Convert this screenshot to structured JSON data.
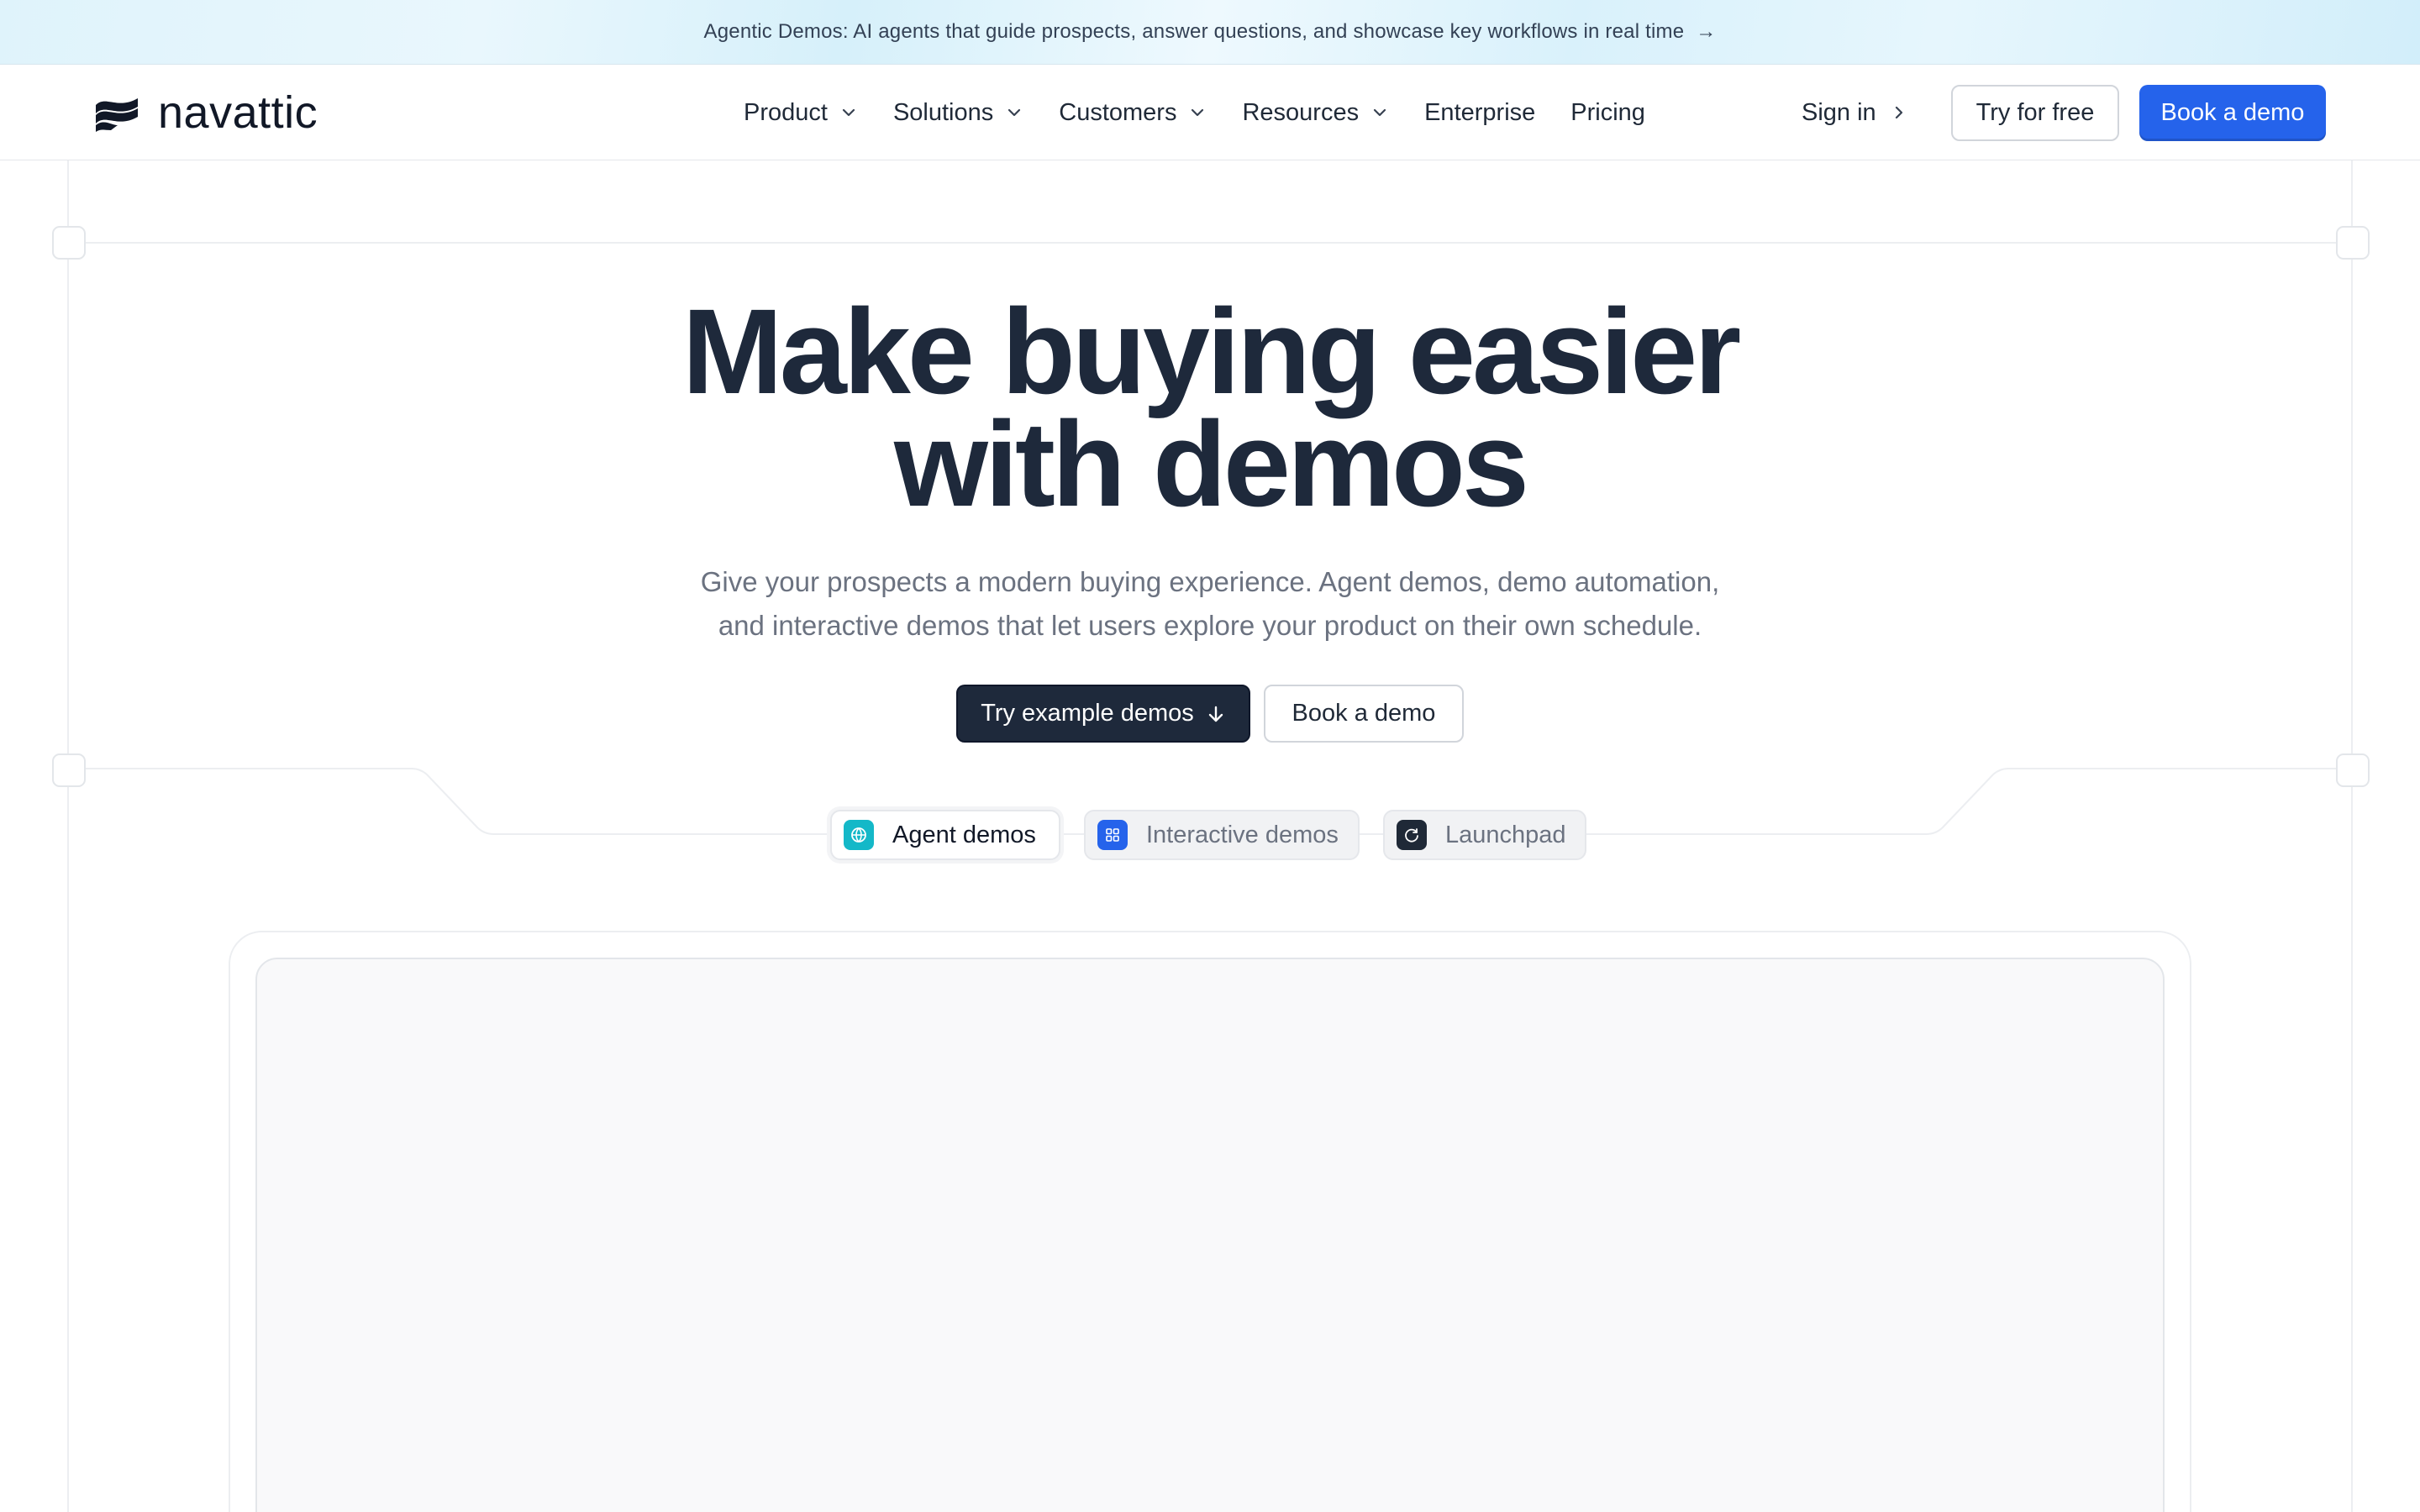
{
  "announcement": {
    "text": "Agentic Demos: AI agents that guide prospects, answer questions, and showcase key workflows in real time",
    "arrow": "→"
  },
  "brand": {
    "name": "navattic",
    "logo_icon": "navattic-wave-logo"
  },
  "nav": {
    "items": [
      {
        "label": "Product",
        "has_dropdown": true
      },
      {
        "label": "Solutions",
        "has_dropdown": true
      },
      {
        "label": "Customers",
        "has_dropdown": true
      },
      {
        "label": "Resources",
        "has_dropdown": true
      },
      {
        "label": "Enterprise",
        "has_dropdown": false
      },
      {
        "label": "Pricing",
        "has_dropdown": false
      }
    ],
    "sign_in": "Sign in",
    "try_free": "Try for free",
    "book_demo": "Book a demo"
  },
  "hero": {
    "title_line1": "Make buying easier",
    "title_line2": "with demos",
    "subtitle_line1": "Give your prospects a modern buying experience. Agent demos, demo automation,",
    "subtitle_line2": "and interactive demos that let users explore your product on their own schedule.",
    "cta_primary": "Try example demos",
    "cta_secondary": "Book a demo"
  },
  "tabs": [
    {
      "label": "Agent demos",
      "icon": "globe-icon",
      "active": true
    },
    {
      "label": "Interactive demos",
      "icon": "grid-icon",
      "active": false
    },
    {
      "label": "Launchpad",
      "icon": "refresh-icon",
      "active": false
    }
  ],
  "colors": {
    "primary_blue": "#2563eb",
    "dark": "#1e293b",
    "agent_teal": "#14b8c8",
    "interactive_blue": "#2563eb",
    "launch_dark": "#1f2937"
  }
}
